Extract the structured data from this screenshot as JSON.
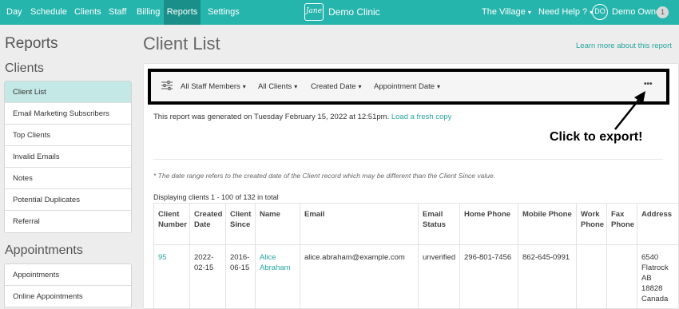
{
  "nav": {
    "items": [
      "Day",
      "Schedule",
      "Clients",
      "Staff",
      "Billing",
      "Reports",
      "Settings"
    ],
    "active": "Reports",
    "logo_text": "Jane",
    "clinic_name": "Demo Clinic",
    "location": "The Village",
    "help": "Need Help ?",
    "avatar_initials": "DO",
    "user_name": "Demo Owner",
    "notification_count": "1"
  },
  "sidebar": {
    "title": "Reports",
    "sections": [
      {
        "heading": "Clients",
        "items": [
          "Client List",
          "Email Marketing Subscribers",
          "Top Clients",
          "Invalid Emails",
          "Notes",
          "Potential Duplicates",
          "Referral"
        ],
        "active": "Client List"
      },
      {
        "heading": "Appointments",
        "items": [
          "Appointments",
          "Online Appointments"
        ]
      }
    ]
  },
  "main": {
    "title": "Client List",
    "learn_more": "Learn more about this report",
    "filters": [
      "All Staff Members",
      "All Clients",
      "Created Date",
      "Appointment Date"
    ],
    "more_label": "•••",
    "generated_text": "This report was generated on Tuesday February 15, 2022 at 12:51pm.",
    "refresh_link": "Load a fresh copy",
    "callout": "Click to export!",
    "footnote": "* The date range refers to the created date of the Client record which may be different than the Client Since value.",
    "displaying": "Displaying clients 1 - 100 of 132 in total"
  },
  "table": {
    "headers": [
      "Client Number",
      "Created Date",
      "Client Since",
      "Name",
      "Email",
      "Email Status",
      "Home Phone",
      "Mobile Phone",
      "Work Phone",
      "Fax Phone",
      "Address"
    ],
    "rows": [
      {
        "client_number": "95",
        "created_date": "2022-02-15",
        "client_since": "2016-06-15",
        "name": "Alice Abraham",
        "email": "alice.abraham@example.com",
        "email_status": "unverified",
        "home_phone": "296-801-7456",
        "mobile_phone": "862-645-0991",
        "work_phone": "",
        "fax_phone": "",
        "address_lines": [
          "6540",
          "Flatrock",
          "AB",
          "18828",
          "Canada"
        ]
      }
    ]
  },
  "colors": {
    "brand": "#26b5ad",
    "nav_active": "#1a8f89",
    "link": "#26a69f",
    "sidebar_active": "#c4e8e6"
  }
}
